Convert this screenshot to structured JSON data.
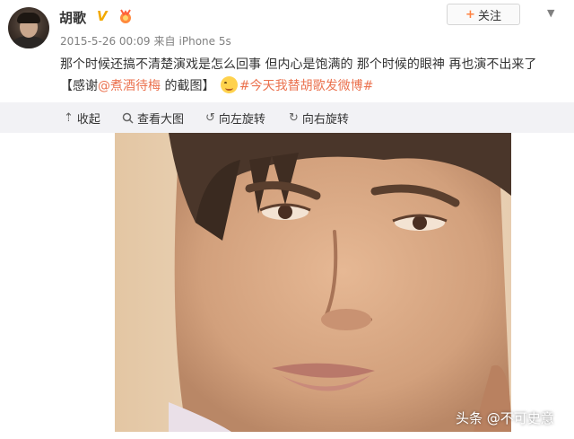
{
  "author": {
    "name": "胡歌",
    "verified_badge": "V"
  },
  "follow_button": {
    "plus": "+",
    "label": "关注"
  },
  "meta": {
    "timestamp": "2015-5-26 00:09",
    "source_prefix": "来自",
    "source": "iPhone 5s"
  },
  "post": {
    "text": "那个时候还搞不清楚演戏是怎么回事 但内心是饱满的 那个时候的眼神 再也演不出来了",
    "thanks_open": "【感谢",
    "mention": "@煮酒待梅",
    "thanks_close": " 的截图】",
    "hashtag": "#今天我替胡歌发微博#"
  },
  "toolbar": {
    "collapse": "收起",
    "view_large": "查看大图",
    "rotate_left": "向左旋转",
    "rotate_right": "向右旋转"
  },
  "icons": {
    "avatar": "portrait-avatar",
    "medal": "medal-icon",
    "chevron": "chevron-down-icon",
    "collapse": "collapse-up-icon",
    "search": "search-icon",
    "rotate_left": "rotate-left-icon",
    "rotate_right": "rotate-right-icon",
    "emoji": "smile-emoji"
  },
  "colors": {
    "link": "#eb7350",
    "badge": "#f2a900",
    "toolbar_bg": "#f2f2f5",
    "follow_plus": "#ff8140"
  },
  "watermark": "头条 @不可史意"
}
